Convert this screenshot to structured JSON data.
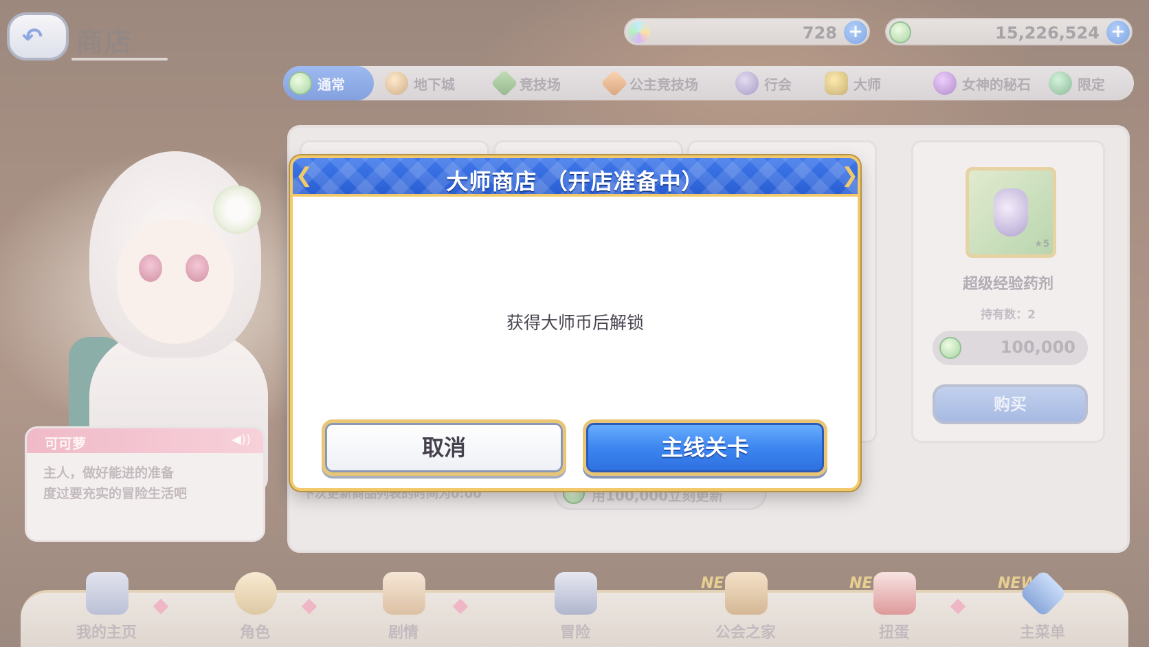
{
  "header": {
    "back_icon": "back-arrow-icon",
    "title": "商店"
  },
  "currencies": {
    "gems": {
      "value": "728",
      "icon": "jewel-icon"
    },
    "mana": {
      "value": "15,226,524",
      "icon": "mana-coin-icon"
    },
    "add_icon": "plus-icon"
  },
  "tabs": [
    {
      "label": "通常",
      "icon": "normal-shop-icon",
      "active": true
    },
    {
      "label": "地下城",
      "icon": "dungeon-coin-icon"
    },
    {
      "label": "竞技场",
      "icon": "arena-coin-icon"
    },
    {
      "label": "公主竞技场",
      "icon": "princess-arena-coin-icon"
    },
    {
      "label": "行会",
      "icon": "clan-coin-icon"
    },
    {
      "label": "大师",
      "icon": "lock-icon"
    },
    {
      "label": "女神的秘石",
      "icon": "goddess-stone-icon"
    },
    {
      "label": "限定",
      "icon": "limited-shop-icon"
    }
  ],
  "shop": {
    "item": {
      "name": "超级经验药剂",
      "stars": "★5",
      "owned": "持有数：2",
      "price": "100,000",
      "buy_label": "购买"
    },
    "refresh_note": "下次更新商品列表的时间为0:00",
    "refresh_button": "用100,000立刻更新"
  },
  "character": {
    "name": "可可萝",
    "line1": "主人，做好能进的准备",
    "line2": "度过要充实的冒险生活吧"
  },
  "modal": {
    "title": "大师商店 （开店准备中）",
    "message": "获得大师币后解锁",
    "cancel_label": "取消",
    "confirm_label": "主线关卡"
  },
  "bottom_nav": [
    {
      "label": "我的主页",
      "icon": "home-castle-icon",
      "new": ""
    },
    {
      "label": "角色",
      "icon": "character-icon",
      "new": ""
    },
    {
      "label": "剧情",
      "icon": "story-scroll-icon",
      "new": ""
    },
    {
      "label": "冒险",
      "icon": "adventure-sword-icon",
      "new": ""
    },
    {
      "label": "公会之家",
      "icon": "guild-house-icon",
      "new": "NEW"
    },
    {
      "label": "扭蛋",
      "icon": "gacha-icon",
      "new": "NEW"
    },
    {
      "label": "主菜单",
      "icon": "main-menu-crystal-icon",
      "new": "NEW"
    }
  ],
  "colors": {
    "primary_blue": "#2a5fd4",
    "gold_border": "#f2c96a",
    "pink_accent": "#e98faa"
  }
}
